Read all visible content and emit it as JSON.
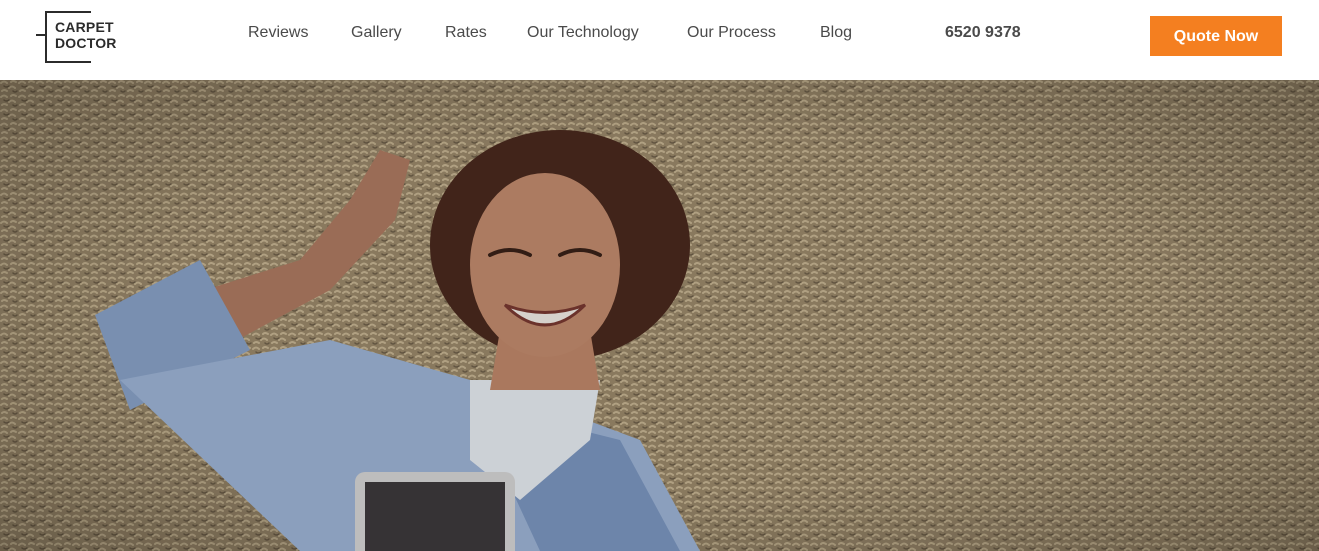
{
  "brand": {
    "line1": "CARPET",
    "line2": "DOCTOR"
  },
  "nav": {
    "items": [
      {
        "label": "Reviews"
      },
      {
        "label": "Gallery"
      },
      {
        "label": "Rates"
      },
      {
        "label": "Our Technology"
      },
      {
        "label": "Our Process"
      },
      {
        "label": "Blog"
      }
    ]
  },
  "contact": {
    "phone": "6520 9378"
  },
  "cta": {
    "label": "Quote Now",
    "color": "#f47f20"
  },
  "hero": {
    "image_description_icon": "woman-lying-on-carpet-photo"
  }
}
